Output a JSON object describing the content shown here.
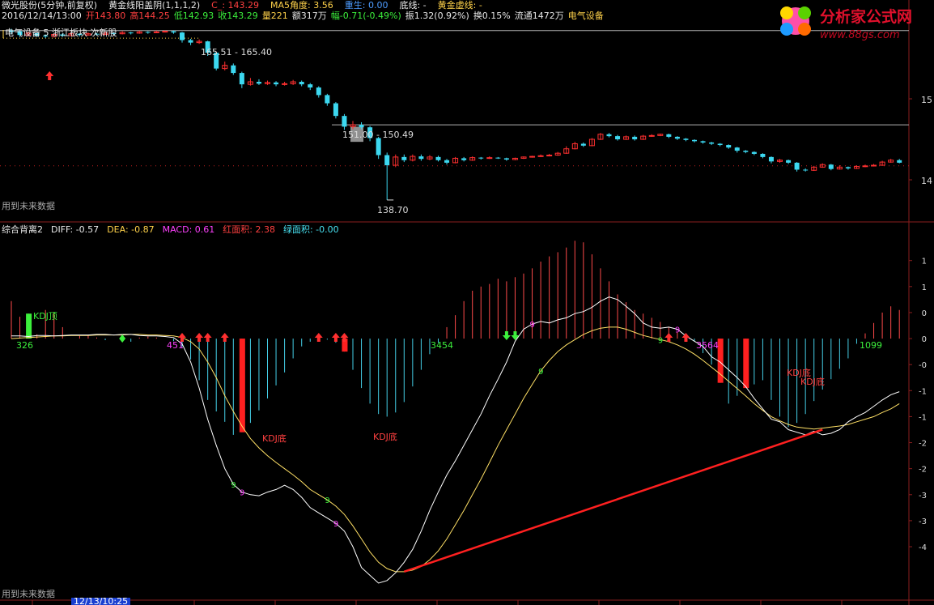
{
  "header": {
    "line1": [
      {
        "text": "微光股份(5分钟,前复权)",
        "color": "#e8e8e8"
      },
      {
        "text": "黄金线阳盖阴(1,1,1,2)",
        "color": "#e8e8e8"
      },
      {
        "text": "C_: 143.29",
        "color": "#ff4040"
      },
      {
        "text": "MA5角度: 3.56",
        "color": "#ffd24a"
      },
      {
        "text": "重生: 0.00",
        "color": "#4d9cff"
      },
      {
        "text": "底线: -",
        "color": "#e8e8e8"
      },
      {
        "text": "黄金虚线: -",
        "color": "#ffd24a"
      }
    ],
    "line2": [
      {
        "text": "2016/12/14/13:00",
        "color": "#e8e8e8"
      },
      {
        "text": "开143.80",
        "color": "#ff4040"
      },
      {
        "text": "高144.25",
        "color": "#ff4040"
      },
      {
        "text": "低142.93",
        "color": "#3cf03c"
      },
      {
        "text": "收143.29",
        "color": "#3cf03c"
      },
      {
        "text": "量221",
        "color": "#ffd24a"
      },
      {
        "text": "额317万",
        "color": "#e8e8e8"
      },
      {
        "text": "幅-0.71(-0.49%)",
        "color": "#3cf03c"
      },
      {
        "text": "振1.32(0.92%)",
        "color": "#e8e8e8"
      },
      {
        "text": "换0.15%",
        "color": "#e8e8e8"
      },
      {
        "text": "流通1472万",
        "color": "#e8e8e8"
      },
      {
        "text": "电气设备",
        "color": "#ffd24a"
      }
    ],
    "line3": "电气设备 5 浙江板块  次新股"
  },
  "logo": {
    "text": "分析家公式网",
    "url_text": "www.88gs.com"
  },
  "top_panel": {
    "future_data_label": "用到未来数据",
    "price_labels": {
      "hi1": "165.51 - 165.40",
      "hi2": "151.00 - 150.49",
      "low": "138.70"
    },
    "y_ticks": [
      "15",
      "14"
    ]
  },
  "bottom_panel": {
    "indicator_line": [
      {
        "text": "综合背离2",
        "color": "#e8e8e8"
      },
      {
        "text": "DIFF: -0.57",
        "color": "#e8e8e8"
      },
      {
        "text": "DEA: -0.87",
        "color": "#ffd24a"
      },
      {
        "text": "MACD: 0.61",
        "color": "#ff40ff"
      },
      {
        "text": "红面积: 2.38",
        "color": "#ff4040"
      },
      {
        "text": "绿面积: -0.00",
        "color": "#47e0f0"
      }
    ],
    "future_data_label": "用到未来数据",
    "y_ticks": [
      "1",
      "1",
      "0",
      "0",
      "-0",
      "-1",
      "-1",
      "-2",
      "-2",
      "-3",
      "-3",
      "-4"
    ],
    "area_labels": [
      {
        "text": "326",
        "color": "#3cf03c",
        "x": 20
      },
      {
        "text": "451",
        "color": "#ff40ff",
        "x": 206
      },
      {
        "text": "3454",
        "color": "#3cf03c",
        "x": 532
      },
      {
        "text": "3564",
        "color": "#ff40ff",
        "x": 860
      },
      {
        "text": "1099",
        "color": "#3cf03c",
        "x": 1062
      }
    ],
    "kdj_labels": [
      {
        "text": "KDJ顶",
        "color": "#3cf03c"
      },
      {
        "text": "KDJ底",
        "color": "#ff4040"
      },
      {
        "text": "KDJ底",
        "color": "#ff4040"
      },
      {
        "text": "KDJ底",
        "color": "#ff4040"
      },
      {
        "text": "KDJ底",
        "color": "#ff4040"
      }
    ]
  },
  "time_axis": {
    "selected_time": "12/13/10:25"
  },
  "chart_data": {
    "type": "line",
    "title": "",
    "price": {
      "ylim": [
        136,
        166.5
      ],
      "candles": [
        [
          165.5,
          165.3,
          165.8,
          164.9
        ],
        [
          165.4,
          164.8,
          165.6,
          164.5
        ],
        [
          164.8,
          165.1,
          165.3,
          164.6
        ],
        [
          165.1,
          164.7,
          165.2,
          164.5
        ],
        [
          164.7,
          164.6,
          164.9,
          164.3
        ],
        [
          164.6,
          164.9,
          165.0,
          164.4
        ],
        [
          164.9,
          164.7,
          165.1,
          164.5
        ],
        [
          164.7,
          165.0,
          165.2,
          164.6
        ],
        [
          165.0,
          164.8,
          165.1,
          164.6
        ],
        [
          164.8,
          165.0,
          165.2,
          164.7
        ],
        [
          165.0,
          164.9,
          165.1,
          164.7
        ],
        [
          164.9,
          165.1,
          165.3,
          164.8
        ],
        [
          165.1,
          165.0,
          165.2,
          164.8
        ],
        [
          165.0,
          165.2,
          165.4,
          164.9
        ],
        [
          165.2,
          165.1,
          165.3,
          164.9
        ],
        [
          165.1,
          165.3,
          165.5,
          165.0
        ],
        [
          165.3,
          165.2,
          165.4,
          165.0
        ],
        [
          165.2,
          165.3,
          165.5,
          165.1
        ],
        [
          165.3,
          165.4,
          165.5,
          165.2
        ],
        [
          165.4,
          165.2,
          165.5,
          165.0
        ],
        [
          165.2,
          164.0,
          165.3,
          163.6
        ],
        [
          164.0,
          163.6,
          164.2,
          163.2
        ],
        [
          163.6,
          163.8,
          164.1,
          163.4
        ],
        [
          163.8,
          162.0,
          163.9,
          161.5
        ],
        [
          162.0,
          159.5,
          162.1,
          159.2
        ],
        [
          159.5,
          160.0,
          160.6,
          159.2
        ],
        [
          160.0,
          158.8,
          160.3,
          158.5
        ],
        [
          158.8,
          157.0,
          159.0,
          156.4
        ],
        [
          157.0,
          157.4,
          158.0,
          156.8
        ],
        [
          157.4,
          157.1,
          157.8,
          156.9
        ],
        [
          157.1,
          157.3,
          157.6,
          156.9
        ],
        [
          157.3,
          157.0,
          157.5,
          156.7
        ],
        [
          157.0,
          157.1,
          157.4,
          156.8
        ],
        [
          157.1,
          157.4,
          157.7,
          156.9
        ],
        [
          157.4,
          157.0,
          157.6,
          156.7
        ],
        [
          157.0,
          156.5,
          157.2,
          156.1
        ],
        [
          156.5,
          155.3,
          156.7,
          154.9
        ],
        [
          155.3,
          154.0,
          155.5,
          153.6
        ],
        [
          154.0,
          152.0,
          154.2,
          151.6
        ],
        [
          152.0,
          150.3,
          152.3,
          149.8
        ],
        [
          150.3,
          150.6,
          151.2,
          149.9
        ],
        [
          150.6,
          150.2,
          151.0,
          149.9
        ],
        [
          150.2,
          148.5,
          150.4,
          148.0
        ],
        [
          148.5,
          145.8,
          148.7,
          145.2
        ],
        [
          145.8,
          144.2,
          146.2,
          138.7
        ],
        [
          144.2,
          145.5,
          145.9,
          143.9
        ],
        [
          145.5,
          145.0,
          145.9,
          144.7
        ],
        [
          145.0,
          145.6,
          145.9,
          144.8
        ],
        [
          145.6,
          145.2,
          145.9,
          144.9
        ],
        [
          145.2,
          145.5,
          145.8,
          145.0
        ],
        [
          145.5,
          145.0,
          145.7,
          144.8
        ],
        [
          145.0,
          144.6,
          145.2,
          144.3
        ],
        [
          144.6,
          145.3,
          145.5,
          144.5
        ],
        [
          145.3,
          145.0,
          145.5,
          144.8
        ],
        [
          145.0,
          145.4,
          145.6,
          144.9
        ],
        [
          145.4,
          145.3,
          145.5,
          145.1
        ],
        [
          145.3,
          145.4,
          145.6,
          145.2
        ],
        [
          145.4,
          145.3,
          145.5,
          145.2
        ],
        [
          145.3,
          145.1,
          145.4,
          144.9
        ],
        [
          145.1,
          145.3,
          145.4,
          145.0
        ],
        [
          145.3,
          145.5,
          145.6,
          145.2
        ],
        [
          145.5,
          145.6,
          145.7,
          145.4
        ],
        [
          145.6,
          145.7,
          145.9,
          145.5
        ],
        [
          145.7,
          145.8,
          146.0,
          145.6
        ],
        [
          145.8,
          146.1,
          146.3,
          145.7
        ],
        [
          146.1,
          146.8,
          147.2,
          146.0
        ],
        [
          146.8,
          147.6,
          147.9,
          146.7
        ],
        [
          147.6,
          147.3,
          147.8,
          147.1
        ],
        [
          147.3,
          148.3,
          148.5,
          147.2
        ],
        [
          148.3,
          149.1,
          149.3,
          148.2
        ],
        [
          149.1,
          148.8,
          149.3,
          148.6
        ],
        [
          148.8,
          148.3,
          149.0,
          148.1
        ],
        [
          148.3,
          148.7,
          148.9,
          148.2
        ],
        [
          148.7,
          148.3,
          148.9,
          148.1
        ],
        [
          148.3,
          148.8,
          149.0,
          148.2
        ],
        [
          148.8,
          148.9,
          149.1,
          148.7
        ],
        [
          148.9,
          149.1,
          149.2,
          148.8
        ],
        [
          149.1,
          148.7,
          149.2,
          148.5
        ],
        [
          148.7,
          148.4,
          148.8,
          148.2
        ],
        [
          148.4,
          148.2,
          148.5,
          148.0
        ],
        [
          148.2,
          148.0,
          148.3,
          147.8
        ],
        [
          148.0,
          147.8,
          148.1,
          147.6
        ],
        [
          147.8,
          147.6,
          147.9,
          147.4
        ],
        [
          147.6,
          147.4,
          147.7,
          147.2
        ],
        [
          147.4,
          147.0,
          147.5,
          146.8
        ],
        [
          147.0,
          146.5,
          147.1,
          146.2
        ],
        [
          146.5,
          146.3,
          146.6,
          146.1
        ],
        [
          146.3,
          146.0,
          146.4,
          145.8
        ],
        [
          146.0,
          145.5,
          146.1,
          145.3
        ],
        [
          145.5,
          144.8,
          145.6,
          144.5
        ],
        [
          144.8,
          145.0,
          145.2,
          144.6
        ],
        [
          145.0,
          144.6,
          145.1,
          144.4
        ],
        [
          144.6,
          143.5,
          144.7,
          143.2
        ],
        [
          143.5,
          143.4,
          143.7,
          143.2
        ],
        [
          143.4,
          143.9,
          144.1,
          143.3
        ],
        [
          143.9,
          144.3,
          144.5,
          143.8
        ],
        [
          144.3,
          143.6,
          144.4,
          143.4
        ],
        [
          143.6,
          143.9,
          144.2,
          143.5
        ],
        [
          143.9,
          143.7,
          144.0,
          143.5
        ],
        [
          143.7,
          144.0,
          144.2,
          143.6
        ],
        [
          144.0,
          144.1,
          144.3,
          143.9
        ],
        [
          144.1,
          144.2,
          144.4,
          144.0
        ],
        [
          144.2,
          144.7,
          144.9,
          144.1
        ],
        [
          144.7,
          145.0,
          145.2,
          144.6
        ],
        [
          145.0,
          144.6,
          145.2,
          144.5
        ]
      ]
    },
    "macd": {
      "ylim": [
        -4.7,
        1.9
      ],
      "bars": [
        0.72,
        0.42,
        0.48,
        0.08,
        0.55,
        0.5,
        0.22,
        0.0,
        0.05,
        0.06,
        0.02,
        -0.03,
        0.0,
        0.08,
        -0.06,
        0.02,
        0.04,
        0.02,
        0.0,
        -0.05,
        -0.16,
        -0.4,
        -0.8,
        -1.18,
        -1.4,
        -1.6,
        -1.85,
        -1.8,
        -1.62,
        -1.38,
        -1.15,
        -0.9,
        -0.65,
        -0.38,
        -0.15,
        -0.06,
        -0.04,
        -0.02,
        -0.08,
        -0.25,
        -0.6,
        -0.95,
        -1.25,
        -1.45,
        -1.5,
        -1.42,
        -1.22,
        -0.92,
        -0.6,
        -0.3,
        -0.08,
        0.22,
        0.45,
        0.72,
        0.92,
        1.0,
        1.05,
        1.15,
        1.1,
        1.18,
        1.25,
        1.35,
        1.48,
        1.58,
        1.66,
        1.75,
        1.88,
        1.85,
        1.62,
        1.35,
        1.1,
        0.85,
        0.7,
        0.55,
        0.48,
        0.4,
        0.32,
        0.22,
        0.12,
        0.03,
        -0.06,
        -0.28,
        -0.5,
        -0.85,
        -1.25,
        -1.1,
        -0.95,
        -0.88,
        -0.8,
        -1.18,
        -1.5,
        -1.7,
        -1.62,
        -1.45,
        -1.2,
        -0.98,
        -0.78,
        -0.58,
        -0.38,
        -0.1,
        0.1,
        0.3,
        0.5,
        0.62,
        0.55
      ],
      "diff": [
        0.05,
        0.05,
        0.04,
        0.06,
        0.06,
        0.05,
        0.06,
        0.07,
        0.07,
        0.07,
        0.08,
        0.08,
        0.07,
        0.08,
        0.08,
        0.06,
        0.05,
        0.05,
        0.04,
        0.02,
        -0.1,
        -0.45,
        -0.95,
        -1.55,
        -2.05,
        -2.5,
        -2.8,
        -2.95,
        -3.0,
        -3.02,
        -2.95,
        -2.9,
        -2.82,
        -2.9,
        -3.05,
        -3.25,
        -3.35,
        -3.45,
        -3.55,
        -3.7,
        -4.0,
        -4.4,
        -4.55,
        -4.7,
        -4.65,
        -4.5,
        -4.3,
        -4.05,
        -3.7,
        -3.3,
        -2.95,
        -2.62,
        -2.35,
        -2.05,
        -1.75,
        -1.45,
        -1.1,
        -0.78,
        -0.45,
        -0.05,
        0.18,
        0.28,
        0.33,
        0.3,
        0.36,
        0.4,
        0.48,
        0.52,
        0.6,
        0.72,
        0.8,
        0.75,
        0.62,
        0.48,
        0.3,
        0.22,
        0.2,
        0.22,
        0.18,
        0.05,
        -0.05,
        -0.15,
        -0.35,
        -0.45,
        -0.6,
        -0.75,
        -0.92,
        -1.15,
        -1.35,
        -1.55,
        -1.6,
        -1.75,
        -1.8,
        -1.85,
        -1.78,
        -1.85,
        -1.82,
        -1.75,
        -1.6,
        -1.5,
        -1.42,
        -1.3,
        -1.18,
        -1.08,
        -1.02
      ],
      "dea": [
        0.0,
        0.01,
        0.02,
        0.03,
        0.04,
        0.05,
        0.05,
        0.06,
        0.06,
        0.06,
        0.07,
        0.07,
        0.07,
        0.07,
        0.08,
        0.08,
        0.07,
        0.07,
        0.06,
        0.05,
        0.02,
        -0.06,
        -0.2,
        -0.45,
        -0.75,
        -1.1,
        -1.4,
        -1.68,
        -1.92,
        -2.1,
        -2.25,
        -2.38,
        -2.5,
        -2.62,
        -2.75,
        -2.9,
        -3.0,
        -3.1,
        -3.22,
        -3.38,
        -3.6,
        -3.85,
        -4.1,
        -4.3,
        -4.42,
        -4.48,
        -4.48,
        -4.45,
        -4.38,
        -4.25,
        -4.08,
        -3.85,
        -3.58,
        -3.3,
        -3.0,
        -2.7,
        -2.38,
        -2.05,
        -1.75,
        -1.45,
        -1.15,
        -0.88,
        -0.62,
        -0.42,
        -0.25,
        -0.12,
        -0.02,
        0.08,
        0.15,
        0.2,
        0.22,
        0.22,
        0.18,
        0.12,
        0.06,
        0.02,
        -0.02,
        -0.06,
        -0.12,
        -0.2,
        -0.3,
        -0.42,
        -0.55,
        -0.68,
        -0.82,
        -0.96,
        -1.1,
        -1.25,
        -1.38,
        -1.5,
        -1.58,
        -1.65,
        -1.7,
        -1.72,
        -1.74,
        -1.72,
        -1.7,
        -1.68,
        -1.65,
        -1.6,
        -1.55,
        -1.5,
        -1.42,
        -1.35,
        -1.25
      ],
      "trend_line": [
        [
          46,
          -4.48
        ],
        [
          95,
          -1.75
        ]
      ]
    },
    "signals": {
      "up_arrows_top": [
        4
      ],
      "up_arrows_macd": [
        20,
        22,
        23,
        25,
        36,
        38,
        39,
        77,
        79
      ],
      "down_arrows_macd": [
        58,
        59
      ],
      "green_diamond": [
        13
      ],
      "thick_bars": [
        {
          "i": 2,
          "color": "#3cf03c"
        },
        {
          "i": 27,
          "color": "#ff2020"
        },
        {
          "i": 39,
          "color": "#ff2020"
        },
        {
          "i": 83,
          "color": "#ff2020"
        },
        {
          "i": 86,
          "color": "#ff2020"
        }
      ],
      "nine_labels": [
        {
          "i": 26,
          "line": "diff",
          "text": "9",
          "color": "#3cf03c"
        },
        {
          "i": 27,
          "line": "diff",
          "text": "9",
          "color": "#ff40ff"
        },
        {
          "i": 37,
          "line": "dea",
          "text": "9",
          "color": "#3cf03c"
        },
        {
          "i": 38,
          "line": "diff",
          "text": "9",
          "color": "#ff40ff"
        },
        {
          "i": 62,
          "line": "dea",
          "text": "9",
          "color": "#3cf03c"
        },
        {
          "i": 61,
          "line": "diff",
          "text": "9",
          "color": "#ff40ff"
        },
        {
          "i": 76,
          "line": "dea",
          "text": "9",
          "color": "#3cf03c"
        },
        {
          "i": 78,
          "line": "diff",
          "text": "9",
          "color": "#ff40ff"
        }
      ]
    }
  }
}
